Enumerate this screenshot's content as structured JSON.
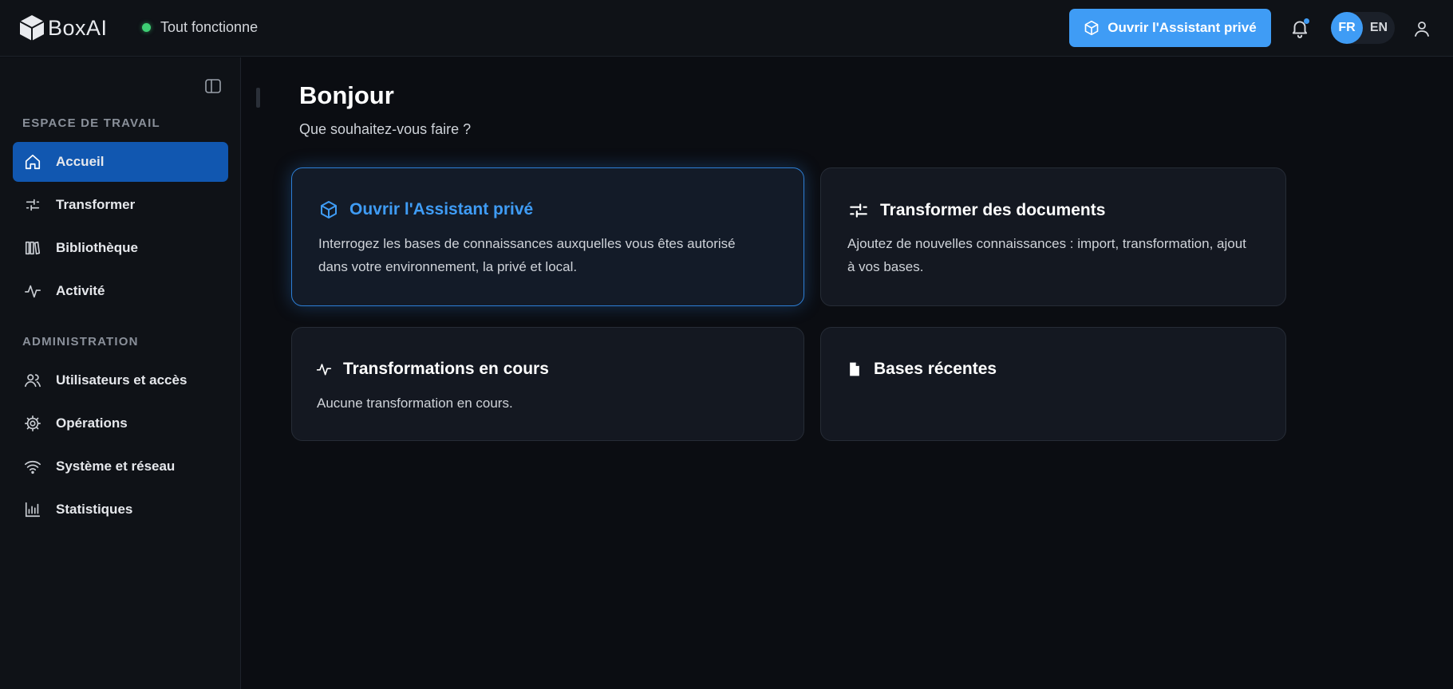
{
  "app": {
    "logo_text": "BoxAI"
  },
  "header": {
    "status_text": "Tout fonctionne",
    "cta_label": "Ouvrir l'Assistant privé",
    "lang_active": "FR",
    "lang_other": "EN"
  },
  "sidebar": {
    "section_workspace": "ESPACE DE TRAVAIL",
    "section_admin": "ADMINISTRATION",
    "items": [
      {
        "label": "Accueil",
        "icon": "home-icon"
      },
      {
        "label": "Transformer",
        "icon": "sliders-icon"
      },
      {
        "label": "Bibliothèque",
        "icon": "library-icon"
      },
      {
        "label": "Activité",
        "icon": "activity-icon"
      },
      {
        "label": "Utilisateurs et accès",
        "icon": "users-icon"
      },
      {
        "label": "Opérations",
        "icon": "gear-icon"
      },
      {
        "label": "Système et réseau",
        "icon": "wifi-icon"
      },
      {
        "label": "Statistiques",
        "icon": "bar-chart-icon"
      }
    ]
  },
  "main": {
    "title": "Bonjour",
    "subtitle": "Que souhaitez-vous faire ?",
    "cards": [
      {
        "title": "Ouvrir l'Assistant privé",
        "desc_line1": "Interrogez les bases de connaissances auxquelles vous êtes autorisé",
        "desc_line2": "dans votre environnement, la privé et local."
      },
      {
        "title": "Transformer des documents",
        "desc_line1": "Ajoutez de nouvelles connaissances : import, transformation, ajout",
        "desc_line2": "à vos bases."
      },
      {
        "title": "Transformations en cours",
        "desc_line1": "Aucune transformation en cours."
      },
      {
        "title": "Bases récentes"
      }
    ]
  },
  "colors": {
    "accent": "#3f9cf5",
    "active_nav": "#1157b0",
    "status_ok": "#3ecf74"
  }
}
